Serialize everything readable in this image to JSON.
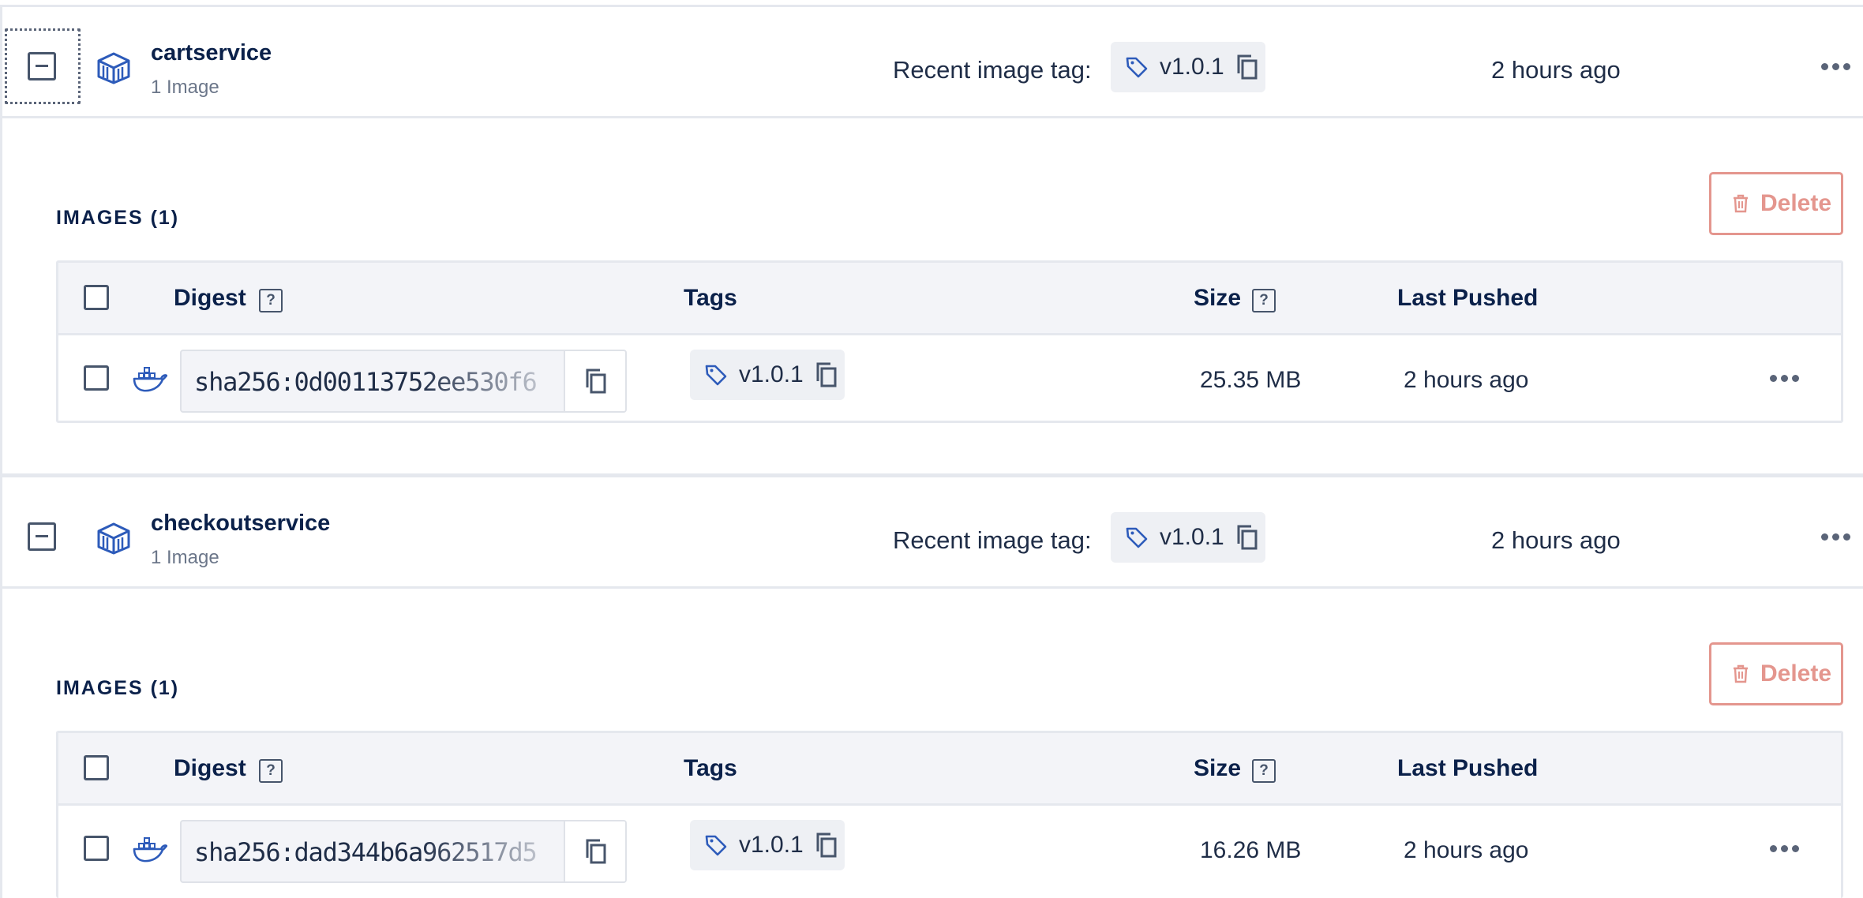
{
  "repositories": [
    {
      "name": "cartservice",
      "count": "1 Image",
      "recent_label": "Recent image tag:",
      "recent_tag": "v1.0.1",
      "time": "2 hours ago",
      "images_heading": "IMAGES (1)",
      "delete_label": "Delete",
      "columns": {
        "digest": "Digest",
        "tags": "Tags",
        "size": "Size",
        "last_pushed": "Last Pushed"
      },
      "help_mark": "?",
      "image": {
        "digest": "sha256:0d00113752ee530f6",
        "tag": "v1.0.1",
        "size": "25.35 MB",
        "last_pushed": "2 hours ago"
      }
    },
    {
      "name": "checkoutservice",
      "count": "1 Image",
      "recent_label": "Recent image tag:",
      "recent_tag": "v1.0.1",
      "time": "2 hours ago",
      "images_heading": "IMAGES (1)",
      "delete_label": "Delete",
      "columns": {
        "digest": "Digest",
        "tags": "Tags",
        "size": "Size",
        "last_pushed": "Last Pushed"
      },
      "help_mark": "?",
      "image": {
        "digest": "sha256:dad344b6a962517d5",
        "tag": "v1.0.1",
        "size": "16.26 MB",
        "last_pushed": "2 hours ago"
      }
    }
  ],
  "icons": [
    "repository-icon",
    "tag-icon",
    "copy-icon",
    "docker-icon",
    "trash-icon",
    "more-icon",
    "help-icon",
    "collapse-icon"
  ],
  "colors": {
    "text": "#0b214a",
    "accent_blue": "#2d5bba",
    "delete": "#e4968e",
    "pill_bg": "#eef0f4",
    "border": "#e5e8ee"
  }
}
